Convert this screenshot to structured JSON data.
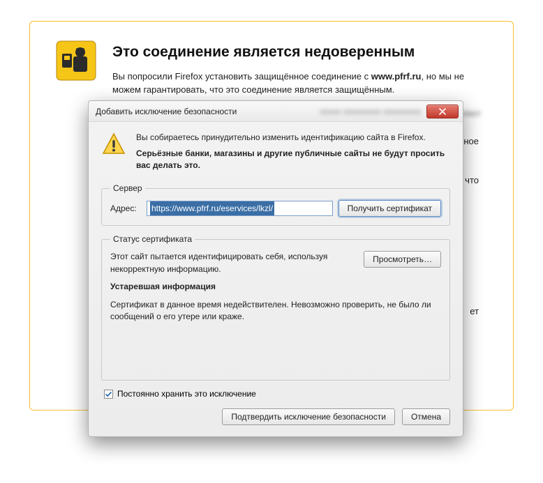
{
  "page": {
    "heading": "Это соединение является недоверенным",
    "para1_prefix": "Вы попросили Firefox установить защищённое соединение с ",
    "para1_bold": "www.pfrf.ru",
    "para1_suffix": ", но мы не можем гарантировать, что это соединение является защищённым.",
    "side_frag1": "ужное",
    "side_frag2": "ь, что",
    "side_frag3": "ет"
  },
  "dialog": {
    "title": "Добавить исключение безопасности",
    "intro": "Вы собираетесь принудительно изменить идентификацию сайта в Firefox.",
    "warn_bold": "Серьёзные банки, магазины и другие публичные сайты не будут просить вас делать это.",
    "server": {
      "legend": "Сервер",
      "addr_label": "Адрес:",
      "addr_value": "https://www.pfrf.ru/eservices/lkzl/",
      "get_cert": "Получить сертификат"
    },
    "status": {
      "legend": "Статус сертификата",
      "desc": "Этот сайт пытается идентифицировать себя, используя некорректную информацию.",
      "view": "Просмотреть…",
      "stale_heading": "Устаревшая информация",
      "stale_text": "Сертификат в данное время недействителен. Невозможно проверить, не было ли сообщений о его утере или краже."
    },
    "store_label": "Постоянно хранить это исключение",
    "confirm": "Подтвердить исключение безопасности",
    "cancel": "Отмена"
  }
}
